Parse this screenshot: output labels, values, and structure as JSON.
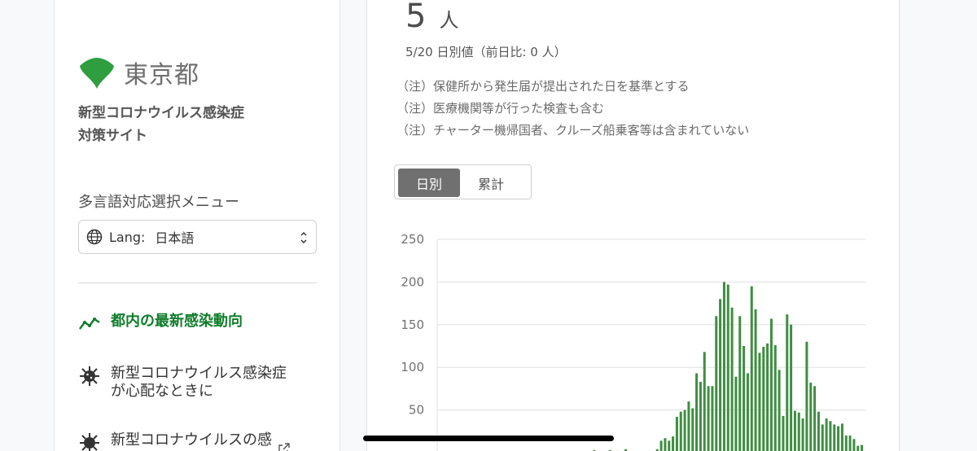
{
  "sidebar": {
    "logo_text": "東京都",
    "site_title_line1": "新型コロナウイルス感染症",
    "site_title_line2": "対策サイト",
    "lang_menu_label": "多言語対応選択メニュー",
    "lang_select": {
      "prefix": "Lang:",
      "value": "日本語"
    },
    "nav": [
      {
        "label": "都内の最新感染動向",
        "icon": "trend-icon",
        "active": true
      },
      {
        "label_line1": "新型コロナウイルス感染症",
        "label_line2": "が心配なときに",
        "icon": "virus-icon"
      },
      {
        "label_line1": "新型コロナウイルスの感",
        "icon": "virus-icon",
        "external": true
      }
    ]
  },
  "card": {
    "value": "5",
    "unit": "人",
    "sub": "5/20 日別値（前日比: 0 人）",
    "notes": [
      "（注）保健所から発生届が提出された日を基準とする",
      "（注）医療機関等が行った検査も含む",
      "（注）チャーター機帰国者、クルーズ船乗客等は含まれていない"
    ],
    "toggle": {
      "daily": "日別",
      "cumulative": "累計",
      "selected": "日別"
    }
  },
  "colors": {
    "accent": "#0f7d2a",
    "bar": "#3e8e41",
    "logo": "#2e9e3f"
  },
  "chart_data": {
    "type": "bar",
    "ylim": [
      0,
      250
    ],
    "yticks": [
      "250",
      "200",
      "150",
      "100",
      "50"
    ],
    "grid": true,
    "values": [
      0,
      0,
      0,
      0,
      0,
      0,
      0,
      0,
      0,
      0,
      0,
      0,
      0,
      0,
      0,
      0,
      0,
      0,
      0,
      0,
      0,
      0,
      0,
      0,
      0,
      0,
      0,
      0,
      0,
      0,
      0,
      0,
      0,
      0,
      0,
      0,
      0,
      0,
      0,
      3,
      0,
      0,
      0,
      3,
      0,
      2,
      0,
      4,
      1,
      0,
      0,
      0,
      0,
      2,
      0,
      4,
      14,
      17,
      14,
      19,
      42,
      48,
      50,
      60,
      52,
      93,
      83,
      118,
      78,
      78,
      160,
      180,
      200,
      197,
      170,
      89,
      160,
      125,
      93,
      195,
      168,
      117,
      124,
      128,
      157,
      126,
      97,
      43,
      162,
      150,
      49,
      47,
      40,
      130,
      82,
      78,
      48,
      33,
      40,
      37,
      33,
      31,
      34,
      20,
      20,
      16,
      8,
      9
    ]
  }
}
